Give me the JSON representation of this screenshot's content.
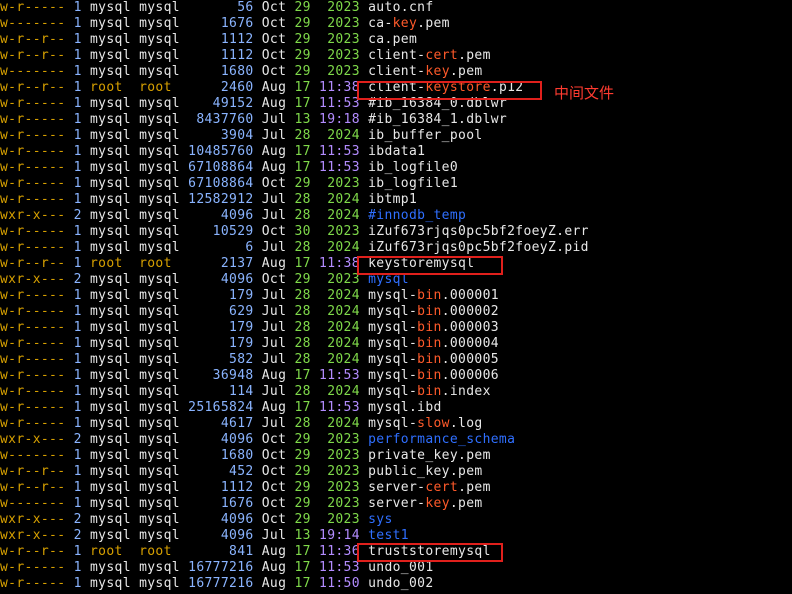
{
  "terminal": {
    "rows": [
      {
        "perm": "w-r-----",
        "links": "1",
        "owner": "mysql",
        "group": "mysql",
        "size": "56",
        "month": "Oct",
        "day": "29",
        "time": "2023",
        "name": [
          {
            "t": "auto.cnf"
          }
        ]
      },
      {
        "perm": "w-------",
        "links": "1",
        "owner": "mysql",
        "group": "mysql",
        "size": "1676",
        "month": "Oct",
        "day": "29",
        "time": "2023",
        "name": [
          {
            "t": "ca-"
          },
          {
            "t": "key",
            "c": "hl"
          },
          {
            "t": ".pem"
          }
        ]
      },
      {
        "perm": "w-r--r--",
        "links": "1",
        "owner": "mysql",
        "group": "mysql",
        "size": "1112",
        "month": "Oct",
        "day": "29",
        "time": "2023",
        "name": [
          {
            "t": "ca.pem"
          }
        ]
      },
      {
        "perm": "w-r--r--",
        "links": "1",
        "owner": "mysql",
        "group": "mysql",
        "size": "1112",
        "month": "Oct",
        "day": "29",
        "time": "2023",
        "name": [
          {
            "t": "client-"
          },
          {
            "t": "cert",
            "c": "hl"
          },
          {
            "t": ".pem"
          }
        ]
      },
      {
        "perm": "w-------",
        "links": "1",
        "owner": "mysql",
        "group": "mysql",
        "size": "1680",
        "month": "Oct",
        "day": "29",
        "time": "2023",
        "name": [
          {
            "t": "client-"
          },
          {
            "t": "key",
            "c": "hl"
          },
          {
            "t": ".pem"
          }
        ]
      },
      {
        "perm": "w-r--r--",
        "links": "1",
        "owner": "root",
        "group": "root",
        "size": "2460",
        "month": "Aug",
        "day": "17",
        "time": "11:38",
        "name": [
          {
            "t": "client-"
          },
          {
            "t": "keystore",
            "c": "hl"
          },
          {
            "t": ".p12"
          }
        ]
      },
      {
        "perm": "w-r-----",
        "links": "1",
        "owner": "mysql",
        "group": "mysql",
        "size": "49152",
        "month": "Aug",
        "day": "17",
        "time": "11:53",
        "name": [
          {
            "t": "#ib_16384_0.dblwr"
          }
        ]
      },
      {
        "perm": "w-r-----",
        "links": "1",
        "owner": "mysql",
        "group": "mysql",
        "size": "8437760",
        "month": "Jul",
        "day": "13",
        "time": "19:18",
        "name": [
          {
            "t": "#ib_16384_1.dblwr"
          }
        ]
      },
      {
        "perm": "w-r-----",
        "links": "1",
        "owner": "mysql",
        "group": "mysql",
        "size": "3904",
        "month": "Jul",
        "day": "28",
        "time": "2024",
        "name": [
          {
            "t": "ib_buffer_pool"
          }
        ]
      },
      {
        "perm": "w-r-----",
        "links": "1",
        "owner": "mysql",
        "group": "mysql",
        "size": "10485760",
        "month": "Aug",
        "day": "17",
        "time": "11:53",
        "name": [
          {
            "t": "ibdata1"
          }
        ]
      },
      {
        "perm": "w-r-----",
        "links": "1",
        "owner": "mysql",
        "group": "mysql",
        "size": "67108864",
        "month": "Aug",
        "day": "17",
        "time": "11:53",
        "name": [
          {
            "t": "ib_logfile0"
          }
        ]
      },
      {
        "perm": "w-r-----",
        "links": "1",
        "owner": "mysql",
        "group": "mysql",
        "size": "67108864",
        "month": "Oct",
        "day": "29",
        "time": "2023",
        "name": [
          {
            "t": "ib_logfile1"
          }
        ]
      },
      {
        "perm": "w-r-----",
        "links": "1",
        "owner": "mysql",
        "group": "mysql",
        "size": "12582912",
        "month": "Jul",
        "day": "28",
        "time": "2024",
        "name": [
          {
            "t": "ibtmp1"
          }
        ]
      },
      {
        "perm": "wxr-x---",
        "links": "2",
        "owner": "mysql",
        "group": "mysql",
        "size": "4096",
        "month": "Jul",
        "day": "28",
        "time": "2024",
        "name": [
          {
            "t": "#innodb_temp",
            "c": "dir"
          }
        ]
      },
      {
        "perm": "w-r-----",
        "links": "1",
        "owner": "mysql",
        "group": "mysql",
        "size": "10529",
        "month": "Oct",
        "day": "30",
        "time": "2023",
        "name": [
          {
            "t": "iZuf673rjqs0pc5bf2foeyZ.err"
          }
        ]
      },
      {
        "perm": "w-r-----",
        "links": "1",
        "owner": "mysql",
        "group": "mysql",
        "size": "6",
        "month": "Jul",
        "day": "28",
        "time": "2024",
        "name": [
          {
            "t": "iZuf673rjqs0pc5bf2foeyZ.pid"
          }
        ]
      },
      {
        "perm": "w-r--r--",
        "links": "1",
        "owner": "root",
        "group": "root",
        "size": "2137",
        "month": "Aug",
        "day": "17",
        "time": "11:38",
        "name": [
          {
            "t": "keystoremysql"
          }
        ]
      },
      {
        "perm": "wxr-x---",
        "links": "2",
        "owner": "mysql",
        "group": "mysql",
        "size": "4096",
        "month": "Oct",
        "day": "29",
        "time": "2023",
        "name": [
          {
            "t": "mysql",
            "c": "dir"
          }
        ]
      },
      {
        "perm": "w-r-----",
        "links": "1",
        "owner": "mysql",
        "group": "mysql",
        "size": "179",
        "month": "Jul",
        "day": "28",
        "time": "2024",
        "name": [
          {
            "t": "mysql-"
          },
          {
            "t": "bin",
            "c": "hl"
          },
          {
            "t": ".000001"
          }
        ]
      },
      {
        "perm": "w-r-----",
        "links": "1",
        "owner": "mysql",
        "group": "mysql",
        "size": "629",
        "month": "Jul",
        "day": "28",
        "time": "2024",
        "name": [
          {
            "t": "mysql-"
          },
          {
            "t": "bin",
            "c": "hl"
          },
          {
            "t": ".000002"
          }
        ]
      },
      {
        "perm": "w-r-----",
        "links": "1",
        "owner": "mysql",
        "group": "mysql",
        "size": "179",
        "month": "Jul",
        "day": "28",
        "time": "2024",
        "name": [
          {
            "t": "mysql-"
          },
          {
            "t": "bin",
            "c": "hl"
          },
          {
            "t": ".000003"
          }
        ]
      },
      {
        "perm": "w-r-----",
        "links": "1",
        "owner": "mysql",
        "group": "mysql",
        "size": "179",
        "month": "Jul",
        "day": "28",
        "time": "2024",
        "name": [
          {
            "t": "mysql-"
          },
          {
            "t": "bin",
            "c": "hl"
          },
          {
            "t": ".000004"
          }
        ]
      },
      {
        "perm": "w-r-----",
        "links": "1",
        "owner": "mysql",
        "group": "mysql",
        "size": "582",
        "month": "Jul",
        "day": "28",
        "time": "2024",
        "name": [
          {
            "t": "mysql-"
          },
          {
            "t": "bin",
            "c": "hl"
          },
          {
            "t": ".000005"
          }
        ]
      },
      {
        "perm": "w-r-----",
        "links": "1",
        "owner": "mysql",
        "group": "mysql",
        "size": "36948",
        "month": "Aug",
        "day": "17",
        "time": "11:53",
        "name": [
          {
            "t": "mysql-"
          },
          {
            "t": "bin",
            "c": "hl"
          },
          {
            "t": ".000006"
          }
        ]
      },
      {
        "perm": "w-r-----",
        "links": "1",
        "owner": "mysql",
        "group": "mysql",
        "size": "114",
        "month": "Jul",
        "day": "28",
        "time": "2024",
        "name": [
          {
            "t": "mysql-"
          },
          {
            "t": "bin",
            "c": "hl"
          },
          {
            "t": ".index"
          }
        ]
      },
      {
        "perm": "w-r-----",
        "links": "1",
        "owner": "mysql",
        "group": "mysql",
        "size": "25165824",
        "month": "Aug",
        "day": "17",
        "time": "11:53",
        "name": [
          {
            "t": "mysql.ibd"
          }
        ]
      },
      {
        "perm": "w-r-----",
        "links": "1",
        "owner": "mysql",
        "group": "mysql",
        "size": "4617",
        "month": "Jul",
        "day": "28",
        "time": "2024",
        "name": [
          {
            "t": "mysql-"
          },
          {
            "t": "slow",
            "c": "hl"
          },
          {
            "t": ".log"
          }
        ]
      },
      {
        "perm": "wxr-x---",
        "links": "2",
        "owner": "mysql",
        "group": "mysql",
        "size": "4096",
        "month": "Oct",
        "day": "29",
        "time": "2023",
        "name": [
          {
            "t": "performance_schema",
            "c": "dir"
          }
        ]
      },
      {
        "perm": "w-------",
        "links": "1",
        "owner": "mysql",
        "group": "mysql",
        "size": "1680",
        "month": "Oct",
        "day": "29",
        "time": "2023",
        "name": [
          {
            "t": "private_key.pem"
          }
        ]
      },
      {
        "perm": "w-r--r--",
        "links": "1",
        "owner": "mysql",
        "group": "mysql",
        "size": "452",
        "month": "Oct",
        "day": "29",
        "time": "2023",
        "name": [
          {
            "t": "public_key.pem"
          }
        ]
      },
      {
        "perm": "w-r--r--",
        "links": "1",
        "owner": "mysql",
        "group": "mysql",
        "size": "1112",
        "month": "Oct",
        "day": "29",
        "time": "2023",
        "name": [
          {
            "t": "server-"
          },
          {
            "t": "cert",
            "c": "hl"
          },
          {
            "t": ".pem"
          }
        ]
      },
      {
        "perm": "w-------",
        "links": "1",
        "owner": "mysql",
        "group": "mysql",
        "size": "1676",
        "month": "Oct",
        "day": "29",
        "time": "2023",
        "name": [
          {
            "t": "server-"
          },
          {
            "t": "key",
            "c": "hl"
          },
          {
            "t": ".pem"
          }
        ]
      },
      {
        "perm": "wxr-x---",
        "links": "2",
        "owner": "mysql",
        "group": "mysql",
        "size": "4096",
        "month": "Oct",
        "day": "29",
        "time": "2023",
        "name": [
          {
            "t": "sys",
            "c": "dir"
          }
        ]
      },
      {
        "perm": "wxr-x---",
        "links": "2",
        "owner": "mysql",
        "group": "mysql",
        "size": "4096",
        "month": "Jul",
        "day": "13",
        "time": "19:14",
        "name": [
          {
            "t": "test1",
            "c": "dir"
          }
        ]
      },
      {
        "perm": "w-r--r--",
        "links": "1",
        "owner": "root",
        "group": "root",
        "size": "841",
        "month": "Aug",
        "day": "17",
        "time": "11:36",
        "name": [
          {
            "t": "truststoremysql"
          }
        ]
      },
      {
        "perm": "w-r-----",
        "links": "1",
        "owner": "mysql",
        "group": "mysql",
        "size": "16777216",
        "month": "Aug",
        "day": "17",
        "time": "11:53",
        "name": [
          {
            "t": "undo_001"
          }
        ]
      },
      {
        "perm": "w-r-----",
        "links": "1",
        "owner": "mysql",
        "group": "mysql",
        "size": "16777216",
        "month": "Aug",
        "day": "17",
        "time": "11:50",
        "name": [
          {
            "t": "undo_002"
          }
        ]
      }
    ]
  },
  "annotation": {
    "label": "中间文件"
  },
  "colors": {
    "background": "#000000",
    "text": "#e8e8e8",
    "permissions": "#d7a000",
    "root_owner": "#d7a000",
    "numbers": "#8ab4ff",
    "day": "#7fd94a",
    "time": "#b38cff",
    "directory": "#2f6fff",
    "filename_highlight": "#ff5a2a",
    "box": "#e0201c",
    "annotation": "#ff3b30"
  }
}
